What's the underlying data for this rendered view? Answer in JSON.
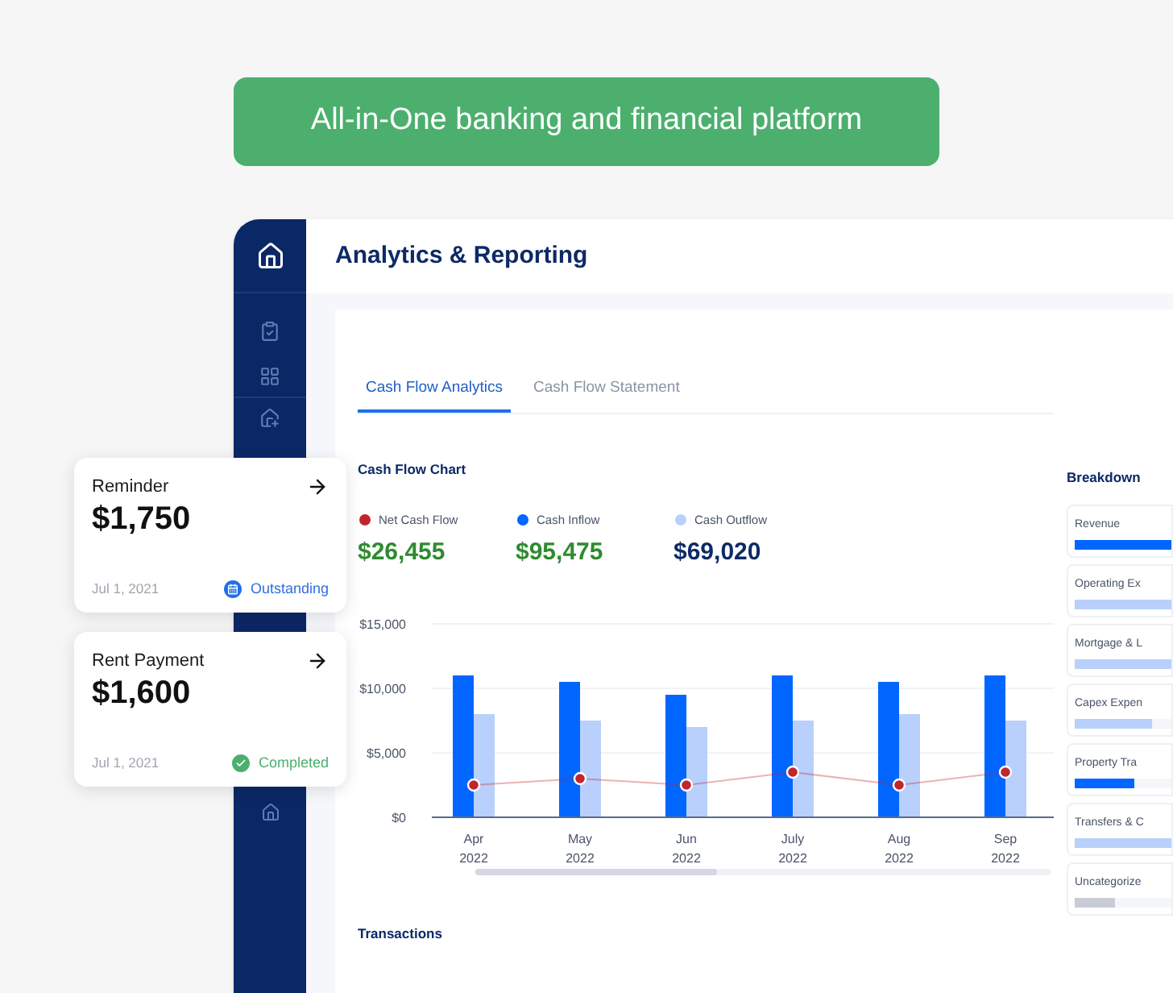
{
  "banner": {
    "text": "All-in-One banking and financial platform"
  },
  "header": {
    "title": "Analytics & Reporting"
  },
  "tabs": [
    {
      "label": "Cash Flow Analytics",
      "selected": true
    },
    {
      "label": "Cash Flow Statement",
      "selected": false
    }
  ],
  "chart_section": {
    "title": "Cash Flow Chart",
    "legend": [
      {
        "value": "$26,455",
        "kind": "positive"
      },
      {
        "value": "$95,475",
        "kind": "positive"
      },
      {
        "value": "$69,020",
        "kind": "neutral"
      }
    ],
    "chart_data": {
      "type": "bar",
      "categories": [
        "Apr 2022",
        "May 2022",
        "Jun 2022",
        "July 2022",
        "Aug 2022",
        "Sep 2022"
      ],
      "series": [
        {
          "name": "Net Cash Flow",
          "color": "#c0262d",
          "type": "line",
          "marker": "o",
          "values": [
            2500,
            3000,
            2500,
            3500,
            2500,
            3500
          ]
        },
        {
          "name": "Cash Inflow",
          "color": "#0066ff",
          "type": "bar",
          "values": [
            11000,
            10500,
            9500,
            11000,
            10500,
            11000
          ]
        },
        {
          "name": "Cash Outflow",
          "color": "#b8d0fb",
          "type": "bar",
          "values": [
            8000,
            7500,
            7000,
            7500,
            8000,
            7500
          ]
        }
      ],
      "ylim": [
        0,
        15000
      ],
      "yticks": [
        {
          "value": 0,
          "label": "$0"
        },
        {
          "value": 5000,
          "label": "$5,000"
        },
        {
          "value": 10000,
          "label": "$10,000"
        },
        {
          "value": 15000,
          "label": "$15,000"
        }
      ]
    }
  },
  "transactions": {
    "title": "Transactions"
  },
  "breakdown": {
    "title": "Breakdown",
    "items": [
      {
        "label": "Revenue",
        "level": 1,
        "color": "#0066ff"
      },
      {
        "label": "Operating Ex",
        "level": 1,
        "color": "#b8d0fb"
      },
      {
        "label": "Mortgage & L",
        "level": 1,
        "color": "#b8d0fb"
      },
      {
        "label": "Capex Expen",
        "level": 0.8,
        "color": "#b8d0fb"
      },
      {
        "label": "Property Tra",
        "level": 0.62,
        "color": "#0066ff"
      },
      {
        "label": "Transfers & C",
        "level": 1,
        "color": "#b8d0fb"
      },
      {
        "label": "Uncategorize",
        "level": 0.42,
        "color": "#c8ccd4"
      }
    ]
  },
  "cards": [
    {
      "title": "Reminder",
      "amount": "$1,750",
      "date": "Jul 1, 2021",
      "status": "Outstanding",
      "kind": "outstanding"
    },
    {
      "title": "Rent Payment",
      "amount": "$1,600",
      "date": "Jul 1, 2021",
      "status": "Completed",
      "kind": "completed"
    }
  ]
}
